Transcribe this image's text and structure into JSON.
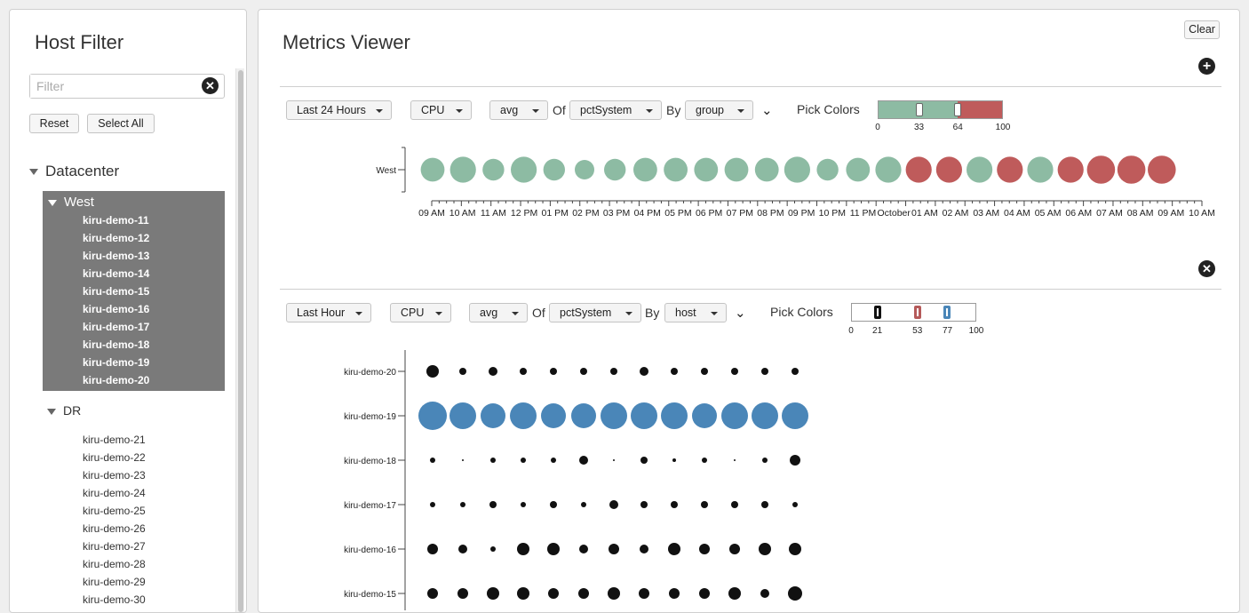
{
  "host_filter": {
    "title": "Host Filter",
    "filter_placeholder": "Filter",
    "filter_value": "",
    "reset_label": "Reset",
    "select_all_label": "Select All",
    "tree_root": "Datacenter",
    "groups": [
      {
        "name": "West",
        "selected": true,
        "hosts": [
          "kiru-demo-11",
          "kiru-demo-12",
          "kiru-demo-13",
          "kiru-demo-14",
          "kiru-demo-15",
          "kiru-demo-16",
          "kiru-demo-17",
          "kiru-demo-18",
          "kiru-demo-19",
          "kiru-demo-20"
        ]
      },
      {
        "name": "DR",
        "selected": false,
        "hosts": [
          "kiru-demo-21",
          "kiru-demo-22",
          "kiru-demo-23",
          "kiru-demo-24",
          "kiru-demo-25",
          "kiru-demo-26",
          "kiru-demo-27",
          "kiru-demo-28",
          "kiru-demo-29",
          "kiru-demo-30"
        ]
      }
    ]
  },
  "metrics_viewer": {
    "title": "Metrics Viewer",
    "clear_label": "Clear",
    "panels": [
      {
        "time_range": "Last 24 Hours",
        "metric": "CPU",
        "agg": "avg",
        "of_label": "Of",
        "field": "pctSystem",
        "by_label": "By",
        "group_by": "group",
        "pick_colors_label": "Pick Colors",
        "scale": {
          "stops": [
            "0",
            "33",
            "64",
            "100"
          ],
          "handles": [
            33,
            64
          ],
          "low_color": "#8dbba3",
          "high_color": "#bf5b5b"
        }
      },
      {
        "time_range": "Last Hour",
        "metric": "CPU",
        "agg": "avg",
        "of_label": "Of",
        "field": "pctSystem",
        "by_label": "By",
        "group_by": "host",
        "pick_colors_label": "Pick Colors",
        "scale": {
          "stops": [
            "0",
            "21",
            "53",
            "77",
            "100"
          ],
          "handles": [
            21,
            53,
            77
          ],
          "handle_colors": [
            "#111111",
            "#b55a5a",
            "#4a86b8"
          ]
        }
      }
    ]
  },
  "chart_data": [
    {
      "type": "scatter",
      "title": "",
      "xlabel": "",
      "ylabel": "",
      "y_categories": [
        "West"
      ],
      "x_tick_labels": [
        "09 AM",
        "10 AM",
        "11 AM",
        "12 PM",
        "01 PM",
        "02 PM",
        "03 PM",
        "04 PM",
        "05 PM",
        "06 PM",
        "07 PM",
        "08 PM",
        "09 PM",
        "10 PM",
        "11 PM",
        "October",
        "01 AM",
        "02 AM",
        "03 AM",
        "04 AM",
        "05 AM",
        "06 AM",
        "07 AM",
        "08 AM",
        "09 AM",
        "10 AM"
      ],
      "colors": {
        "green": "#8dbba3",
        "red": "#bf5b5b"
      },
      "series": [
        {
          "category": "West",
          "sizes": [
            2,
            3,
            1,
            3,
            1,
            0,
            1,
            2,
            2,
            2,
            2,
            2,
            3,
            1,
            2,
            3,
            3,
            3,
            3,
            3,
            3,
            3,
            4,
            4,
            4
          ],
          "colors": [
            "green",
            "green",
            "green",
            "green",
            "green",
            "green",
            "green",
            "green",
            "green",
            "green",
            "green",
            "green",
            "green",
            "green",
            "green",
            "green",
            "red",
            "red",
            "green",
            "red",
            "green",
            "red",
            "red",
            "red",
            "red"
          ]
        }
      ]
    },
    {
      "type": "scatter",
      "title": "",
      "xlabel": "",
      "ylabel": "",
      "y_categories": [
        "kiru-demo-20",
        "kiru-demo-19",
        "kiru-demo-18",
        "kiru-demo-17",
        "kiru-demo-16",
        "kiru-demo-15"
      ],
      "colors": {
        "black": "#111111",
        "blue": "#4a86b8"
      },
      "series": [
        {
          "category": "kiru-demo-20",
          "color": "black",
          "sizes": [
            7,
            4,
            5,
            4,
            4,
            4,
            4,
            5,
            4,
            4,
            4,
            4,
            4
          ]
        },
        {
          "category": "kiru-demo-19",
          "color": "blue",
          "sizes": [
            16,
            15,
            14,
            15,
            14,
            14,
            15,
            15,
            15,
            14,
            15,
            15,
            15
          ]
        },
        {
          "category": "kiru-demo-18",
          "color": "black",
          "sizes": [
            3,
            1,
            3,
            3,
            3,
            5,
            1,
            4,
            2,
            3,
            1,
            3,
            6
          ]
        },
        {
          "category": "kiru-demo-17",
          "color": "black",
          "sizes": [
            3,
            3,
            4,
            3,
            4,
            3,
            5,
            4,
            4,
            4,
            4,
            4,
            3
          ]
        },
        {
          "category": "kiru-demo-16",
          "color": "black",
          "sizes": [
            6,
            5,
            3,
            7,
            7,
            5,
            6,
            5,
            7,
            6,
            6,
            7,
            7
          ]
        },
        {
          "category": "kiru-demo-15",
          "color": "black",
          "sizes": [
            6,
            6,
            7,
            7,
            6,
            6,
            7,
            6,
            6,
            6,
            7,
            5,
            8
          ]
        }
      ]
    }
  ]
}
